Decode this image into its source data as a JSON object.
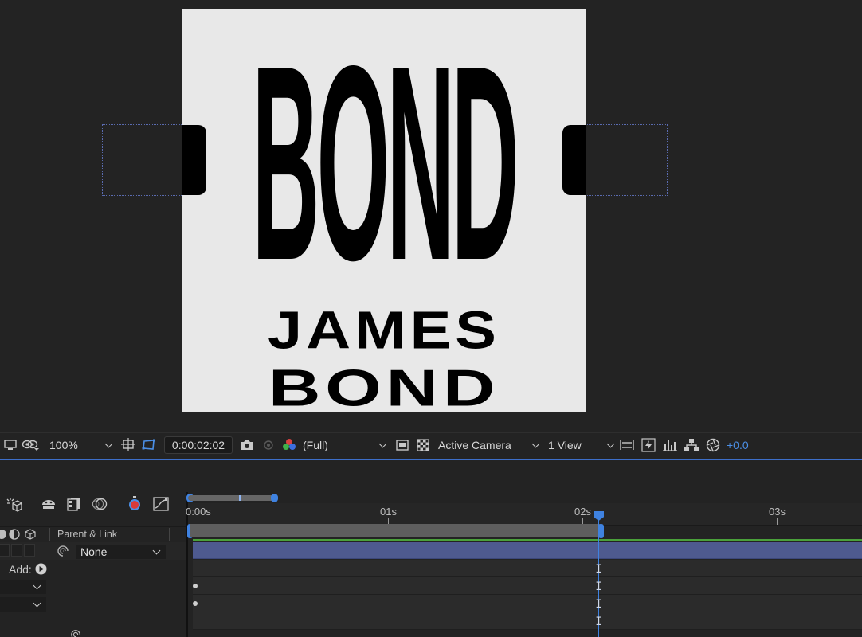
{
  "composition": {
    "text_bond_large": "BOND",
    "text_james": "JAMES",
    "text_bond_small": "BOND"
  },
  "viewer_toolbar": {
    "zoom": "100%",
    "timecode": "0:00:02:02",
    "resolution": "(Full)",
    "camera": "Active Camera",
    "view_layout": "1 View",
    "exposure": "+0.0"
  },
  "timeline": {
    "ruler": {
      "labels": [
        "0:00s",
        "01s",
        "02s",
        "03s"
      ]
    },
    "column_header": {
      "parent_link": "Parent & Link"
    },
    "layer": {
      "parent_value": "None"
    },
    "add_label": "Add:",
    "playhead_time": "0:00:02:02"
  },
  "colors": {
    "accent": "#3f82e0",
    "layer_bar": "#4e5a8f",
    "green_bar": "#4aa13a",
    "canvas_bg": "#e8e8e8"
  }
}
